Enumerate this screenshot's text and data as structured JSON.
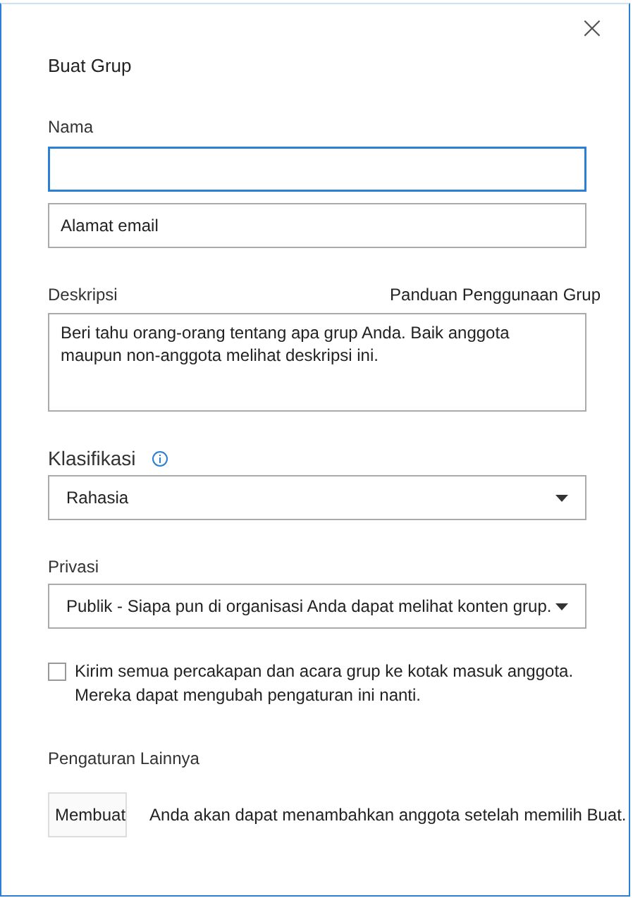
{
  "dialog": {
    "title": "Buat Grup",
    "close": "×"
  },
  "name_field": {
    "label": "Nama",
    "focused": true
  },
  "email_field": {
    "placeholder": "Alamat email",
    "focused": false
  },
  "description": {
    "label": "Deskripsi",
    "link": "Panduan Penggunaan Grup",
    "placeholder": "Beri tahu orang-orang tentang apa grup Anda. Baik anggota maupun non-anggota melihat deskripsi ini."
  },
  "classification": {
    "label": "Klasifikasi",
    "value": "Rahasia"
  },
  "privacy": {
    "label": "Privasi",
    "value": "Publik - Siapa pun di organisasi Anda dapat melihat konten grup."
  },
  "subscribe": {
    "label": "Kirim semua percakapan dan acara grup ke kotak masuk anggota. Mereka dapat mengubah pengaturan ini nanti.",
    "checked": false
  },
  "more_settings": "Pengaturan Lainnya",
  "create_button": "Membuat",
  "footer_note": "Anda akan dapat menambahkan anggota setelah memilih Buat."
}
